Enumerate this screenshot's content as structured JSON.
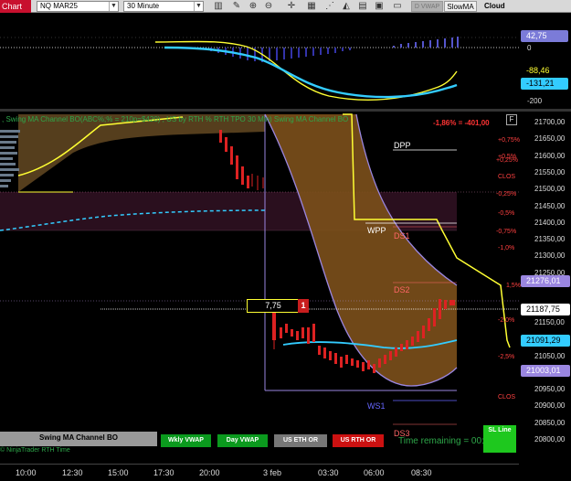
{
  "toolbar": {
    "chart_tab": "Chart",
    "instrument": "NQ MAR25",
    "interval": "30 Minute",
    "btn_dvwap": "D VWAP",
    "btn_slowma": "SlowMA",
    "cloud": "Cloud",
    "icons": [
      "bar-chart-icon",
      "pencil-icon",
      "zoom-in-icon",
      "zoom-out-icon",
      "crosshair-icon",
      "grid-icon",
      "indicators-icon",
      "strategy-icon",
      "templates-icon",
      "layout-icon",
      "properties-icon"
    ]
  },
  "osc_axis": {
    "label_42": "42,75",
    "label_0": "0",
    "label_m88": "-88,46",
    "label_m131": "-131,21",
    "label_m200": "-200",
    "colors": {
      "tag_42": "#7b7bd8",
      "tag_m88": "#ffff33",
      "tag_m131": "#33ccff"
    }
  },
  "main": {
    "header_text": "  , Swing MA Channel BO(ABC%;% = 210p=$420) , US by RTH % RTH TPO 30 Min) Swing MA Channel BO",
    "pct_label": "-1,86% = -401,00",
    "f_button": "F",
    "levels": {
      "dpp": "DPP",
      "wpp": "WPP",
      "ds1": "DS1",
      "ds2": "DS2",
      "ws1": "WS1",
      "ds3": "DS3"
    },
    "value_box": "7,75",
    "value_box_badge": "1",
    "time_remaining": "Time remaining = 00:11:35",
    "bottom_left": "Swing MA Channel BO",
    "bottom_left_sub": "  © NinjaTrader RTH Time",
    "buttons": {
      "wkly_vwap": "Wkly VWAP",
      "day_vwap": "Day VWAP",
      "us_eth_or": "US ETH OR",
      "us_rth_or": "US RTH OR",
      "sl_line": "SL Line"
    }
  },
  "price_axis": {
    "ticks": [
      "21700,00",
      "21650,00",
      "21600,00",
      "21550,00",
      "21500,00",
      "21450,00",
      "21400,00",
      "21350,00",
      "21300,00",
      "21250,00",
      "21150,00",
      "21050,00",
      "20950,00",
      "20900,00",
      "20850,00",
      "20800,00"
    ],
    "pct_labels": [
      "+0,75%",
      "+0,5%",
      "+0,25%",
      "CLOS",
      "-0,25%",
      "-0,5%",
      "-0,75%",
      "-1,0%",
      "1,5%",
      "-2,0%",
      "-2,5%",
      "CLOS"
    ],
    "tags": {
      "p21276": "21276,01",
      "p21187": "21187,75",
      "p21091": "21091,29",
      "p21003": "21003,01"
    },
    "colors": {
      "p21276": "#9a86e0",
      "p21187": "#ffffff",
      "p21091": "#33ccff",
      "p21003": "#9a86e0"
    }
  },
  "time_axis": {
    "labels": [
      "10:00",
      "12:30",
      "15:00",
      "17:30",
      "20:00",
      "3 feb",
      "03:30",
      "06:00",
      "08:30"
    ]
  }
}
